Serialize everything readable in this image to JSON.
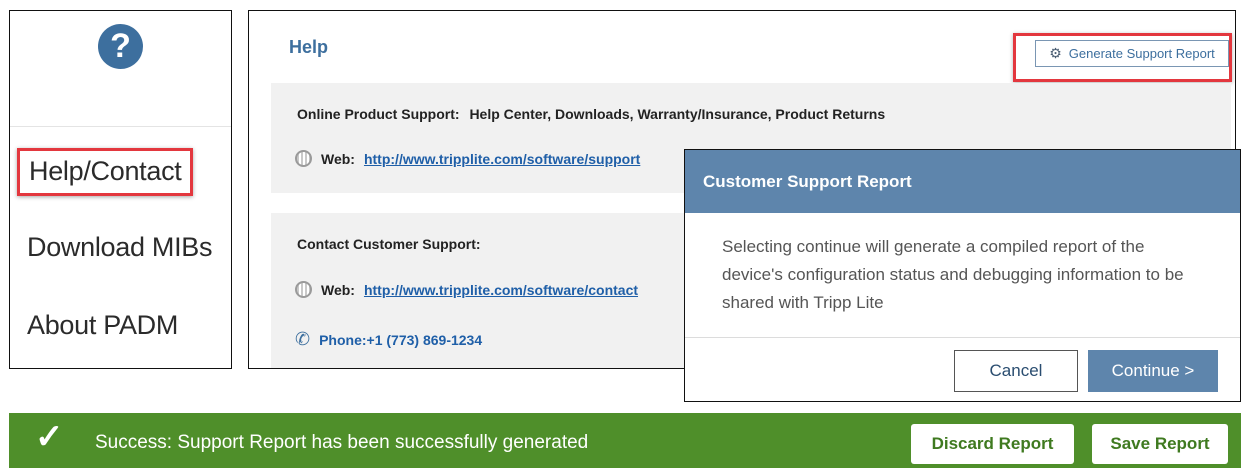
{
  "sidebar": {
    "help_icon": "?",
    "items": [
      {
        "label": "Help/Contact",
        "active": true
      },
      {
        "label": "Download MIBs",
        "active": false
      },
      {
        "label": "About PADM",
        "active": false
      }
    ]
  },
  "help_page": {
    "title": "Help",
    "generate_button_label": "Generate Support Report",
    "gear_icon": "⚙",
    "online_support": {
      "heading_label": "Online Product Support:",
      "heading_detail": "Help Center, Downloads, Warranty/Insurance, Product Returns",
      "web_label": "Web:",
      "web_url": "http://www.tripplite.com/software/support"
    },
    "contact_support": {
      "heading": "Contact Customer Support:",
      "web_label": "Web:",
      "web_url": "http://www.tripplite.com/software/contact",
      "phone": "Phone:+1 (773) 869-1234",
      "phone_icon": "✆"
    }
  },
  "modal": {
    "title": "Customer Support Report",
    "body": "Selecting continue will generate a compiled report of the device's configuration status and debugging information to be shared with Tripp Lite",
    "cancel_label": "Cancel",
    "continue_label": "Continue >"
  },
  "success_bar": {
    "check_icon": "✓",
    "message": "Success: Support Report has been successfully generated",
    "discard_label": "Discard Report",
    "save_label": "Save Report"
  },
  "colors": {
    "brand_blue": "#3d6f9e",
    "modal_blue": "#5e85ac",
    "highlight_red": "#e3373e",
    "success_green": "#4f8f2a"
  }
}
